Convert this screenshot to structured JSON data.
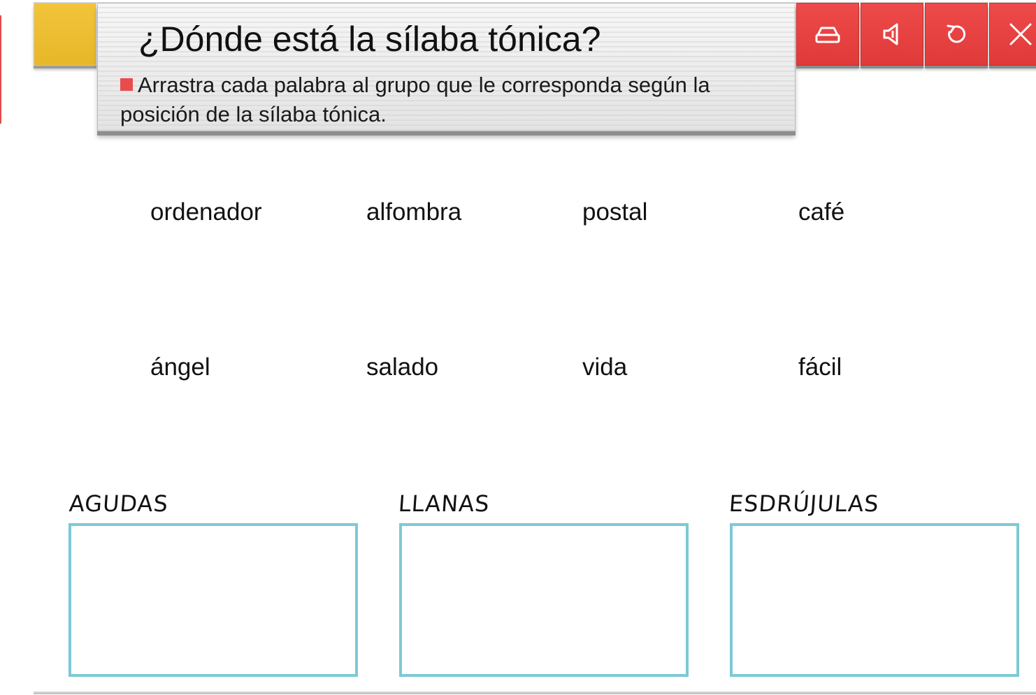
{
  "header": {
    "title": "¿Dónde está la sílaba tónica?",
    "instruction": "Arrastra cada palabra al grupo que le corresponda según la posición de la sílaba tónica."
  },
  "toolbar": {
    "buttons": [
      {
        "icon": "eraser-icon",
        "name": "clear"
      },
      {
        "icon": "speaker-icon",
        "name": "audio"
      },
      {
        "icon": "refresh-icon",
        "name": "reset"
      },
      {
        "icon": "close-icon",
        "name": "close"
      }
    ]
  },
  "words": [
    "ordenador",
    "alfombra",
    "postal",
    "café",
    "ángel",
    "salado",
    "vida",
    "fácil"
  ],
  "groups": [
    {
      "label": "AGUDAS"
    },
    {
      "label": "LLANAS"
    },
    {
      "label": "ESDRÚJULAS"
    }
  ],
  "colors": {
    "accent_yellow": "#f2c43a",
    "toolbar_red": "#e84545",
    "bullet_red": "#e84c4c",
    "drop_border": "#7cc9d6"
  }
}
